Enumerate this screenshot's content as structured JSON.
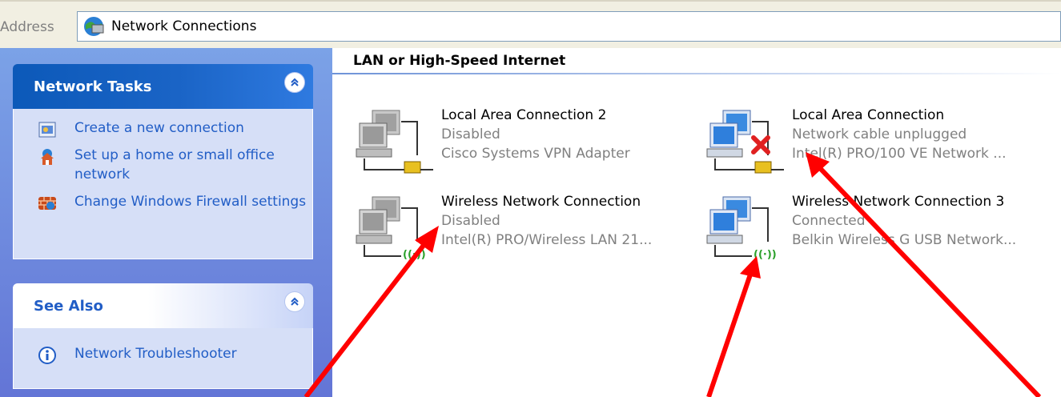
{
  "address_bar": {
    "label": "Address",
    "value": "Network Connections"
  },
  "sidebar": {
    "network_tasks": {
      "title": "Network Tasks",
      "items": [
        {
          "label": "Create a new connection",
          "icon": "new-connection-icon"
        },
        {
          "label": "Set up a home or small office network",
          "icon": "home-network-icon"
        },
        {
          "label": "Change Windows Firewall settings",
          "icon": "firewall-icon"
        }
      ]
    },
    "see_also": {
      "title": "See Also",
      "items": [
        {
          "label": "Network Troubleshooter",
          "icon": "info-icon"
        }
      ]
    }
  },
  "content": {
    "group_title": "LAN or High-Speed Internet",
    "connections": [
      {
        "name": "Local Area Connection 2",
        "status": "Disabled",
        "device": "Cisco Systems VPN Adapter",
        "type": "lan",
        "state": "disabled"
      },
      {
        "name": "Local Area Connection",
        "status": "Network cable unplugged",
        "device": "Intel(R) PRO/100 VE Network ...",
        "type": "lan",
        "state": "unplugged"
      },
      {
        "name": "Wireless Network Connection",
        "status": "Disabled",
        "device": "Intel(R) PRO/Wireless LAN 21...",
        "type": "wireless",
        "state": "disabled"
      },
      {
        "name": "Wireless Network Connection 3",
        "status": "Connected",
        "device": "Belkin Wireless G USB Network...",
        "type": "wireless",
        "state": "connected"
      }
    ]
  },
  "annotation_color": "#ff0000"
}
